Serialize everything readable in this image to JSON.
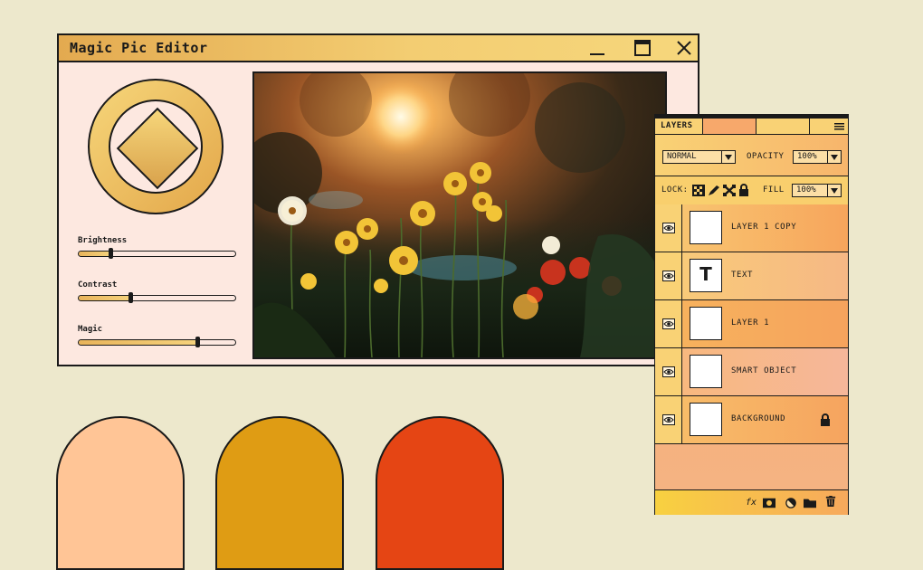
{
  "window": {
    "title": "Magic Pic Editor",
    "titlebar_colors": [
      "#e3aa50",
      "#f6d77c"
    ]
  },
  "adjustments": [
    {
      "label": "Brightness",
      "value": 0.2
    },
    {
      "label": "Contrast",
      "value": 0.33
    },
    {
      "label": "Magic",
      "value": 0.76
    }
  ],
  "layers_panel": {
    "tab_label": "LAYERS",
    "blend_mode": "NORMAL",
    "opacity_label": "OPACITY",
    "opacity_value": "100%",
    "lock_label": "LOCK:",
    "fill_label": "FILL",
    "fill_value": "100%",
    "layers": [
      {
        "name": "LAYER 1 COPY",
        "thumb": "blank"
      },
      {
        "name": "TEXT",
        "thumb": "text",
        "glyph": "T"
      },
      {
        "name": "LAYER 1",
        "thumb": "blank"
      },
      {
        "name": "SMART OBJECT",
        "thumb": "blank"
      },
      {
        "name": "BACKGROUND",
        "thumb": "blank",
        "locked": true
      }
    ],
    "footer": {
      "fx_label": "fx"
    }
  },
  "swatches": [
    "#ffc596",
    "#df9c14",
    "#e54514"
  ]
}
